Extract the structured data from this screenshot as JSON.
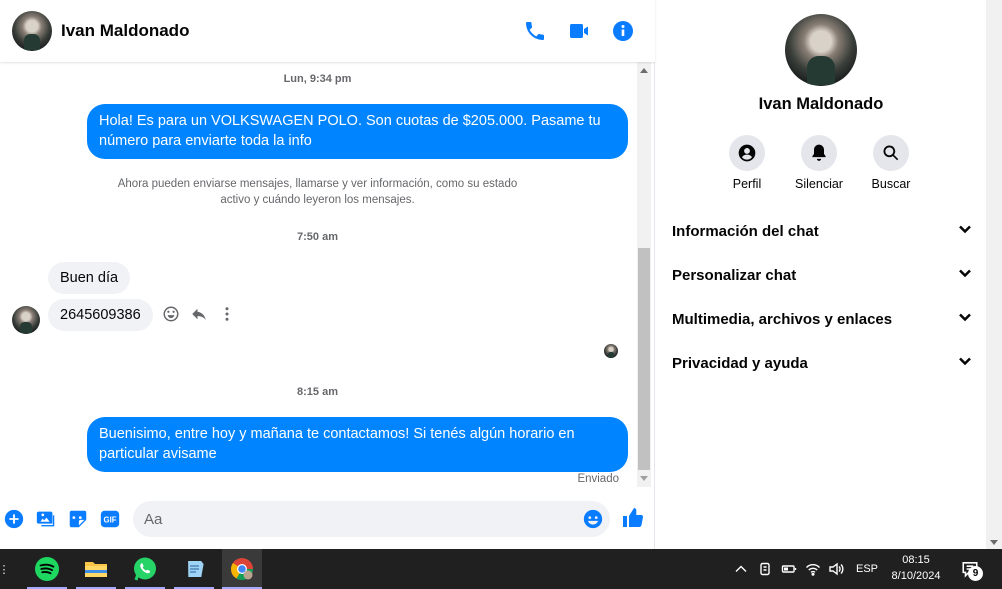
{
  "chat": {
    "contact_name": "Ivan Maldonado",
    "header_icons": [
      "phone-icon",
      "video-camera-icon",
      "info-icon"
    ],
    "messages": [
      {
        "type": "timestamp",
        "text": "Lun, 9:34 pm"
      },
      {
        "type": "outgoing",
        "text": "Hola! Es para un VOLKSWAGEN POLO. Son cuotas de $205.000. Pasame tu número para enviarte toda la info"
      },
      {
        "type": "notice",
        "line1": "Ahora pueden enviarse mensajes, llamarse y ver información, como su estado",
        "line2": "activo y cuándo leyeron los mensajes."
      },
      {
        "type": "timestamp",
        "text": "7:50 am"
      },
      {
        "type": "incoming",
        "text": "Buen día"
      },
      {
        "type": "incoming",
        "text": "2645609386"
      },
      {
        "type": "timestamp",
        "text": "8:15 am"
      },
      {
        "type": "outgoing",
        "text": "Buenisimo, entre hoy y mañana te contactamos! Si tenés algún horario en particular avisame"
      }
    ],
    "status": "Enviado",
    "composer": {
      "placeholder": "Aa",
      "icons": [
        "plus-circle-icon",
        "image-icon",
        "sticker-icon",
        "gif-icon",
        "emoji-icon",
        "thumbs-up-icon"
      ]
    },
    "accent_color": "#0084ff"
  },
  "info_panel": {
    "name": "Ivan Maldonado",
    "actions": [
      {
        "label": "Perfil",
        "icon": "profile-icon"
      },
      {
        "label": "Silenciar",
        "icon": "bell-icon"
      },
      {
        "label": "Buscar",
        "icon": "search-icon"
      }
    ],
    "sections": [
      {
        "title": "Información del chat"
      },
      {
        "title": "Personalizar chat"
      },
      {
        "title": "Multimedia, archivos y enlaces"
      },
      {
        "title": "Privacidad y ayuda"
      }
    ]
  },
  "taskbar": {
    "apps": [
      "spotify-icon",
      "file-explorer-icon",
      "whatsapp-icon",
      "notes-icon",
      "chrome-icon"
    ],
    "language": "ESP",
    "time": "08:15",
    "date": "8/10/2024",
    "notifications": "9"
  }
}
